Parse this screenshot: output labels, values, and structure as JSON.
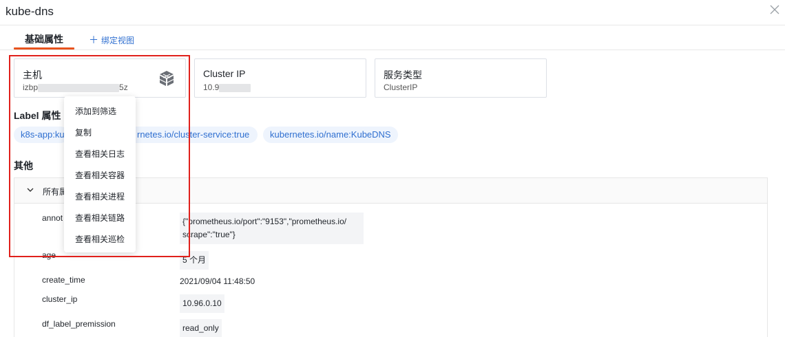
{
  "header": {
    "title": "kube-dns"
  },
  "tabs": {
    "active_label": "基础属性",
    "add_label": "绑定视图",
    "add_symbol": "＋"
  },
  "cards": {
    "host": {
      "label": "主机",
      "value_prefix": "izbp",
      "value_suffix": "5z"
    },
    "cluster_ip": {
      "label": "Cluster IP",
      "value_prefix": "10.9"
    },
    "service_type": {
      "label": "服务类型",
      "value": "ClusterIP"
    }
  },
  "labels_section": {
    "title": "Label 属性",
    "tags": [
      "k8s-app:ku",
      "rnetes.io/cluster-service:true",
      "kubernetes.io/name:KubeDNS"
    ]
  },
  "other_section": {
    "title": "其他",
    "panel_title": "所有属",
    "rows": [
      {
        "key": "annot",
        "value_line1": "{\"prometheus.io/port\":\"9153\",\"prometheus.io/",
        "value_line2": "scrape\":\"true\"}"
      },
      {
        "key": "age",
        "value": "5 个月"
      },
      {
        "key": "create_time",
        "value": "2021/09/04 11:48:50"
      },
      {
        "key": "cluster_ip",
        "value": "10.96.0.10"
      },
      {
        "key": "df_label_premission",
        "value": "read_only"
      }
    ]
  },
  "context_menu": {
    "items": [
      "添加到筛选",
      "复制",
      "查看相关日志",
      "查看相关容器",
      "查看相关进程",
      "查看相关链路",
      "查看相关巡检"
    ]
  },
  "colors": {
    "accent": "#e8531d",
    "link": "#2f6fd0",
    "highlight": "#e0201b",
    "tag_bg": "#eef4fd"
  },
  "icons": {
    "close": "close-icon",
    "cube": "cube-stack-icon",
    "chevron": "chevron-down-icon"
  }
}
